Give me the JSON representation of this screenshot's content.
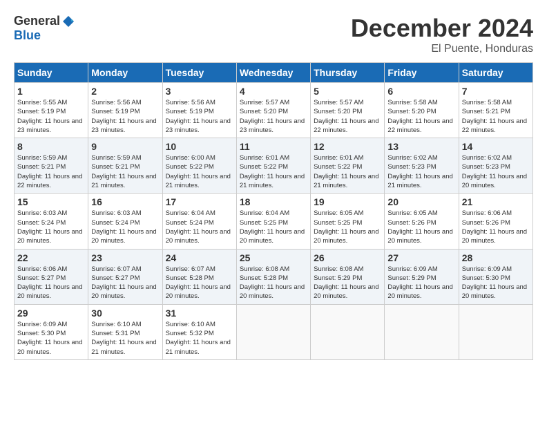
{
  "logo": {
    "general": "General",
    "blue": "Blue"
  },
  "title": "December 2024",
  "location": "El Puente, Honduras",
  "days_of_week": [
    "Sunday",
    "Monday",
    "Tuesday",
    "Wednesday",
    "Thursday",
    "Friday",
    "Saturday"
  ],
  "weeks": [
    [
      {
        "day": "1",
        "sunrise": "5:55 AM",
        "sunset": "5:19 PM",
        "daylight": "11 hours and 23 minutes."
      },
      {
        "day": "2",
        "sunrise": "5:56 AM",
        "sunset": "5:19 PM",
        "daylight": "11 hours and 23 minutes."
      },
      {
        "day": "3",
        "sunrise": "5:56 AM",
        "sunset": "5:19 PM",
        "daylight": "11 hours and 23 minutes."
      },
      {
        "day": "4",
        "sunrise": "5:57 AM",
        "sunset": "5:20 PM",
        "daylight": "11 hours and 23 minutes."
      },
      {
        "day": "5",
        "sunrise": "5:57 AM",
        "sunset": "5:20 PM",
        "daylight": "11 hours and 22 minutes."
      },
      {
        "day": "6",
        "sunrise": "5:58 AM",
        "sunset": "5:20 PM",
        "daylight": "11 hours and 22 minutes."
      },
      {
        "day": "7",
        "sunrise": "5:58 AM",
        "sunset": "5:21 PM",
        "daylight": "11 hours and 22 minutes."
      }
    ],
    [
      {
        "day": "8",
        "sunrise": "5:59 AM",
        "sunset": "5:21 PM",
        "daylight": "11 hours and 22 minutes."
      },
      {
        "day": "9",
        "sunrise": "5:59 AM",
        "sunset": "5:21 PM",
        "daylight": "11 hours and 21 minutes."
      },
      {
        "day": "10",
        "sunrise": "6:00 AM",
        "sunset": "5:22 PM",
        "daylight": "11 hours and 21 minutes."
      },
      {
        "day": "11",
        "sunrise": "6:01 AM",
        "sunset": "5:22 PM",
        "daylight": "11 hours and 21 minutes."
      },
      {
        "day": "12",
        "sunrise": "6:01 AM",
        "sunset": "5:22 PM",
        "daylight": "11 hours and 21 minutes."
      },
      {
        "day": "13",
        "sunrise": "6:02 AM",
        "sunset": "5:23 PM",
        "daylight": "11 hours and 21 minutes."
      },
      {
        "day": "14",
        "sunrise": "6:02 AM",
        "sunset": "5:23 PM",
        "daylight": "11 hours and 20 minutes."
      }
    ],
    [
      {
        "day": "15",
        "sunrise": "6:03 AM",
        "sunset": "5:24 PM",
        "daylight": "11 hours and 20 minutes."
      },
      {
        "day": "16",
        "sunrise": "6:03 AM",
        "sunset": "5:24 PM",
        "daylight": "11 hours and 20 minutes."
      },
      {
        "day": "17",
        "sunrise": "6:04 AM",
        "sunset": "5:24 PM",
        "daylight": "11 hours and 20 minutes."
      },
      {
        "day": "18",
        "sunrise": "6:04 AM",
        "sunset": "5:25 PM",
        "daylight": "11 hours and 20 minutes."
      },
      {
        "day": "19",
        "sunrise": "6:05 AM",
        "sunset": "5:25 PM",
        "daylight": "11 hours and 20 minutes."
      },
      {
        "day": "20",
        "sunrise": "6:05 AM",
        "sunset": "5:26 PM",
        "daylight": "11 hours and 20 minutes."
      },
      {
        "day": "21",
        "sunrise": "6:06 AM",
        "sunset": "5:26 PM",
        "daylight": "11 hours and 20 minutes."
      }
    ],
    [
      {
        "day": "22",
        "sunrise": "6:06 AM",
        "sunset": "5:27 PM",
        "daylight": "11 hours and 20 minutes."
      },
      {
        "day": "23",
        "sunrise": "6:07 AM",
        "sunset": "5:27 PM",
        "daylight": "11 hours and 20 minutes."
      },
      {
        "day": "24",
        "sunrise": "6:07 AM",
        "sunset": "5:28 PM",
        "daylight": "11 hours and 20 minutes."
      },
      {
        "day": "25",
        "sunrise": "6:08 AM",
        "sunset": "5:28 PM",
        "daylight": "11 hours and 20 minutes."
      },
      {
        "day": "26",
        "sunrise": "6:08 AM",
        "sunset": "5:29 PM",
        "daylight": "11 hours and 20 minutes."
      },
      {
        "day": "27",
        "sunrise": "6:09 AM",
        "sunset": "5:29 PM",
        "daylight": "11 hours and 20 minutes."
      },
      {
        "day": "28",
        "sunrise": "6:09 AM",
        "sunset": "5:30 PM",
        "daylight": "11 hours and 20 minutes."
      }
    ],
    [
      {
        "day": "29",
        "sunrise": "6:09 AM",
        "sunset": "5:30 PM",
        "daylight": "11 hours and 20 minutes."
      },
      {
        "day": "30",
        "sunrise": "6:10 AM",
        "sunset": "5:31 PM",
        "daylight": "11 hours and 21 minutes."
      },
      {
        "day": "31",
        "sunrise": "6:10 AM",
        "sunset": "5:32 PM",
        "daylight": "11 hours and 21 minutes."
      },
      null,
      null,
      null,
      null
    ]
  ]
}
